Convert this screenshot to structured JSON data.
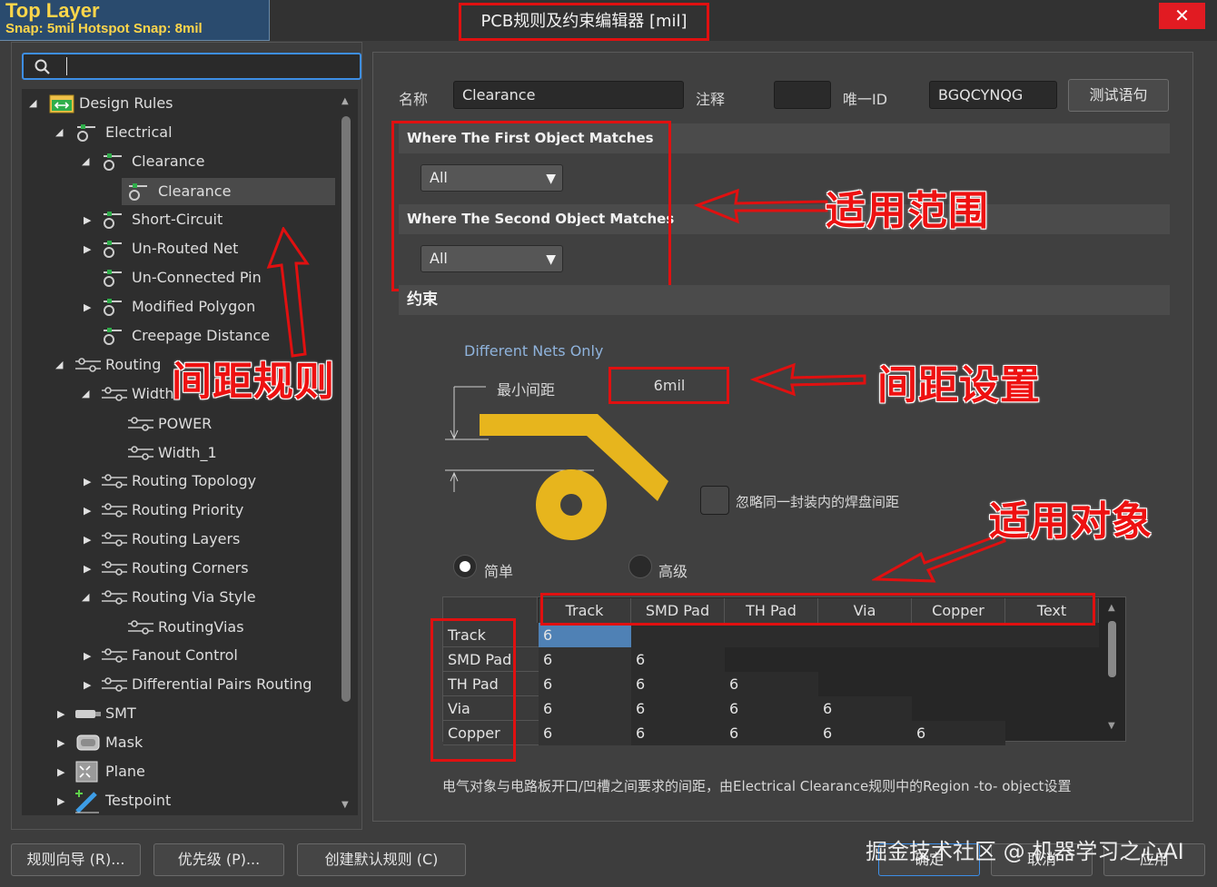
{
  "titlebar": {
    "layer_title": "Top Layer",
    "snap_info": "Snap: 5mil Hotspot Snap: 8mil",
    "dialog_title": "PCB规则及约束编辑器 [mil]",
    "close": "✕"
  },
  "tree": {
    "items": [
      {
        "label": "Design Rules"
      },
      {
        "label": "Electrical"
      },
      {
        "label": "Clearance"
      },
      {
        "label": "Clearance"
      },
      {
        "label": "Short-Circuit"
      },
      {
        "label": "Un-Routed Net"
      },
      {
        "label": "Un-Connected Pin"
      },
      {
        "label": "Modified Polygon"
      },
      {
        "label": "Creepage Distance"
      },
      {
        "label": "Routing"
      },
      {
        "label": "Width"
      },
      {
        "label": "POWER"
      },
      {
        "label": "Width_1"
      },
      {
        "label": "Routing Topology"
      },
      {
        "label": "Routing Priority"
      },
      {
        "label": "Routing Layers"
      },
      {
        "label": "Routing Corners"
      },
      {
        "label": "Routing Via Style"
      },
      {
        "label": "RoutingVias"
      },
      {
        "label": "Fanout Control"
      },
      {
        "label": "Differential Pairs Routing"
      },
      {
        "label": "SMT"
      },
      {
        "label": "Mask"
      },
      {
        "label": "Plane"
      },
      {
        "label": "Testpoint"
      }
    ]
  },
  "rule": {
    "name_label": "名称",
    "name_value": "Clearance",
    "comment_label": "注释",
    "comment_value": "",
    "uid_label": "唯一ID",
    "uid_value": "BGQCYNQG",
    "test_button": "测试语句"
  },
  "scope": {
    "first_title": "Where The First Object Matches",
    "first_value": "All",
    "second_title": "Where The Second Object Matches",
    "second_value": "All"
  },
  "constraints": {
    "title": "约束",
    "different_nets": "Different Nets Only",
    "min_clearance_label": "最小间距",
    "min_clearance_value": "6mil",
    "ignore_pads": "忽略同一封装内的焊盘间距",
    "simple": "简单",
    "advanced": "高级",
    "footer_note": "电气对象与电路板开口/凹槽之间要求的间距，由Electrical Clearance规则中的Region -to- object设置"
  },
  "grid": {
    "columns": [
      "Track",
      "SMD Pad",
      "TH Pad",
      "Via",
      "Copper",
      "Text"
    ],
    "rows": [
      {
        "name": "Track",
        "values": [
          "6"
        ]
      },
      {
        "name": "SMD Pad",
        "values": [
          "6",
          "6"
        ]
      },
      {
        "name": "TH Pad",
        "values": [
          "6",
          "6",
          "6"
        ]
      },
      {
        "name": "Via",
        "values": [
          "6",
          "6",
          "6",
          "6"
        ]
      },
      {
        "name": "Copper",
        "values": [
          "6",
          "6",
          "6",
          "6",
          "6"
        ]
      }
    ]
  },
  "annotations": {
    "scope": "适用范围",
    "spacing_rule": "间距规则",
    "spacing_setting": "间距设置",
    "objects": "适用对象"
  },
  "bottom": {
    "rule_wizard": "规则向导 (R)...",
    "priority": "优先级 (P)...",
    "create_default": "创建默认规则 (C)",
    "ok": "确定",
    "cancel": "取消",
    "apply": "应用"
  },
  "watermark": "掘金技术社区 @ 机器学习之心AI",
  "colors": {
    "accent_blue": "#3d8ee6",
    "annotation_red": "#e01010",
    "copper_yellow": "#e7b51d",
    "selected_cell": "#4f81b5"
  }
}
